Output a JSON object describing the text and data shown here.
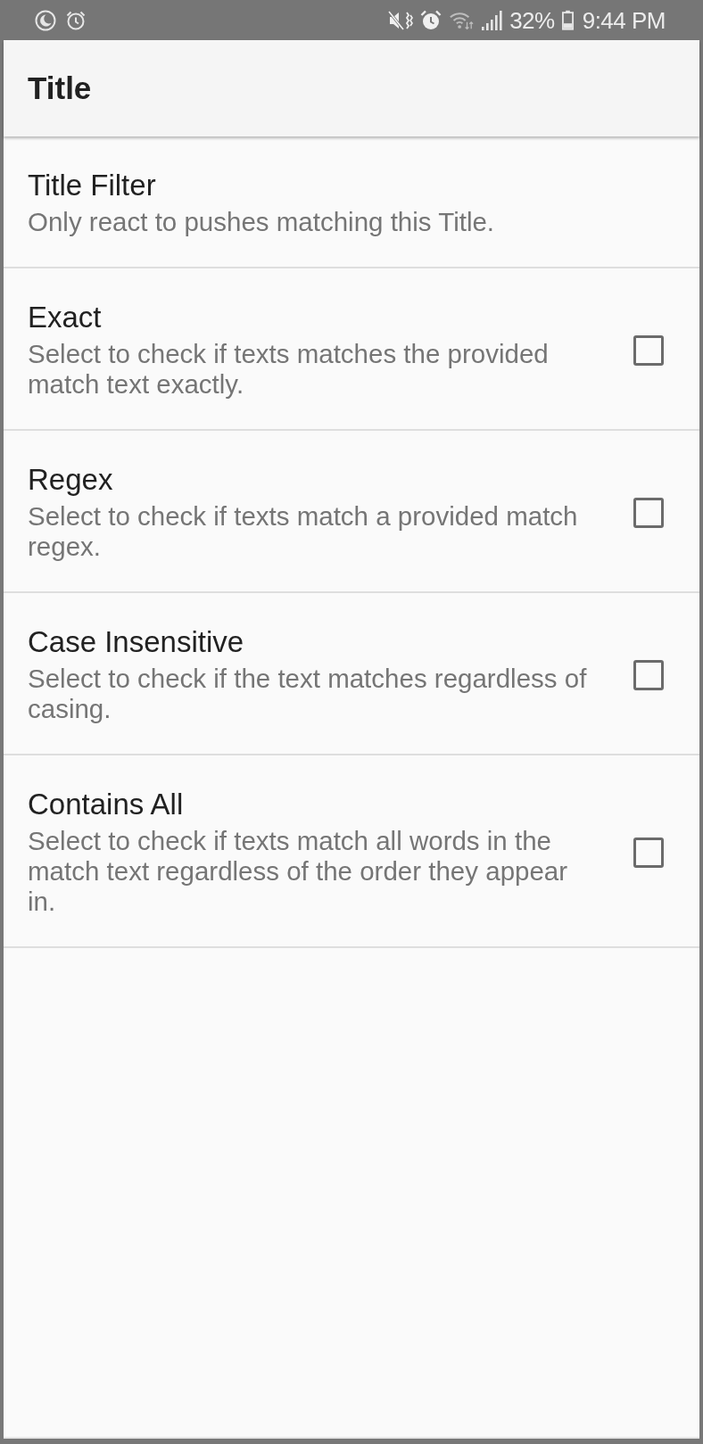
{
  "status_bar": {
    "battery": "32%",
    "time": "9:44 PM"
  },
  "app_bar": {
    "title": "Title"
  },
  "settings": [
    {
      "kind": "text",
      "title": "Title Filter",
      "summary": "Only react to pushes matching this Title."
    },
    {
      "kind": "checkbox",
      "title": "Exact",
      "summary": "Select to check if texts matches the provided match text exactly.",
      "checked": false
    },
    {
      "kind": "checkbox",
      "title": "Regex",
      "summary": "Select to check if texts match a provided match regex.",
      "checked": false
    },
    {
      "kind": "checkbox",
      "title": "Case Insensitive",
      "summary": "Select to check if the text matches regardless of casing.",
      "checked": false
    },
    {
      "kind": "checkbox",
      "title": "Contains All",
      "summary": "Select to check if texts match all words in the match text regardless of the order they appear in.",
      "checked": false
    }
  ]
}
